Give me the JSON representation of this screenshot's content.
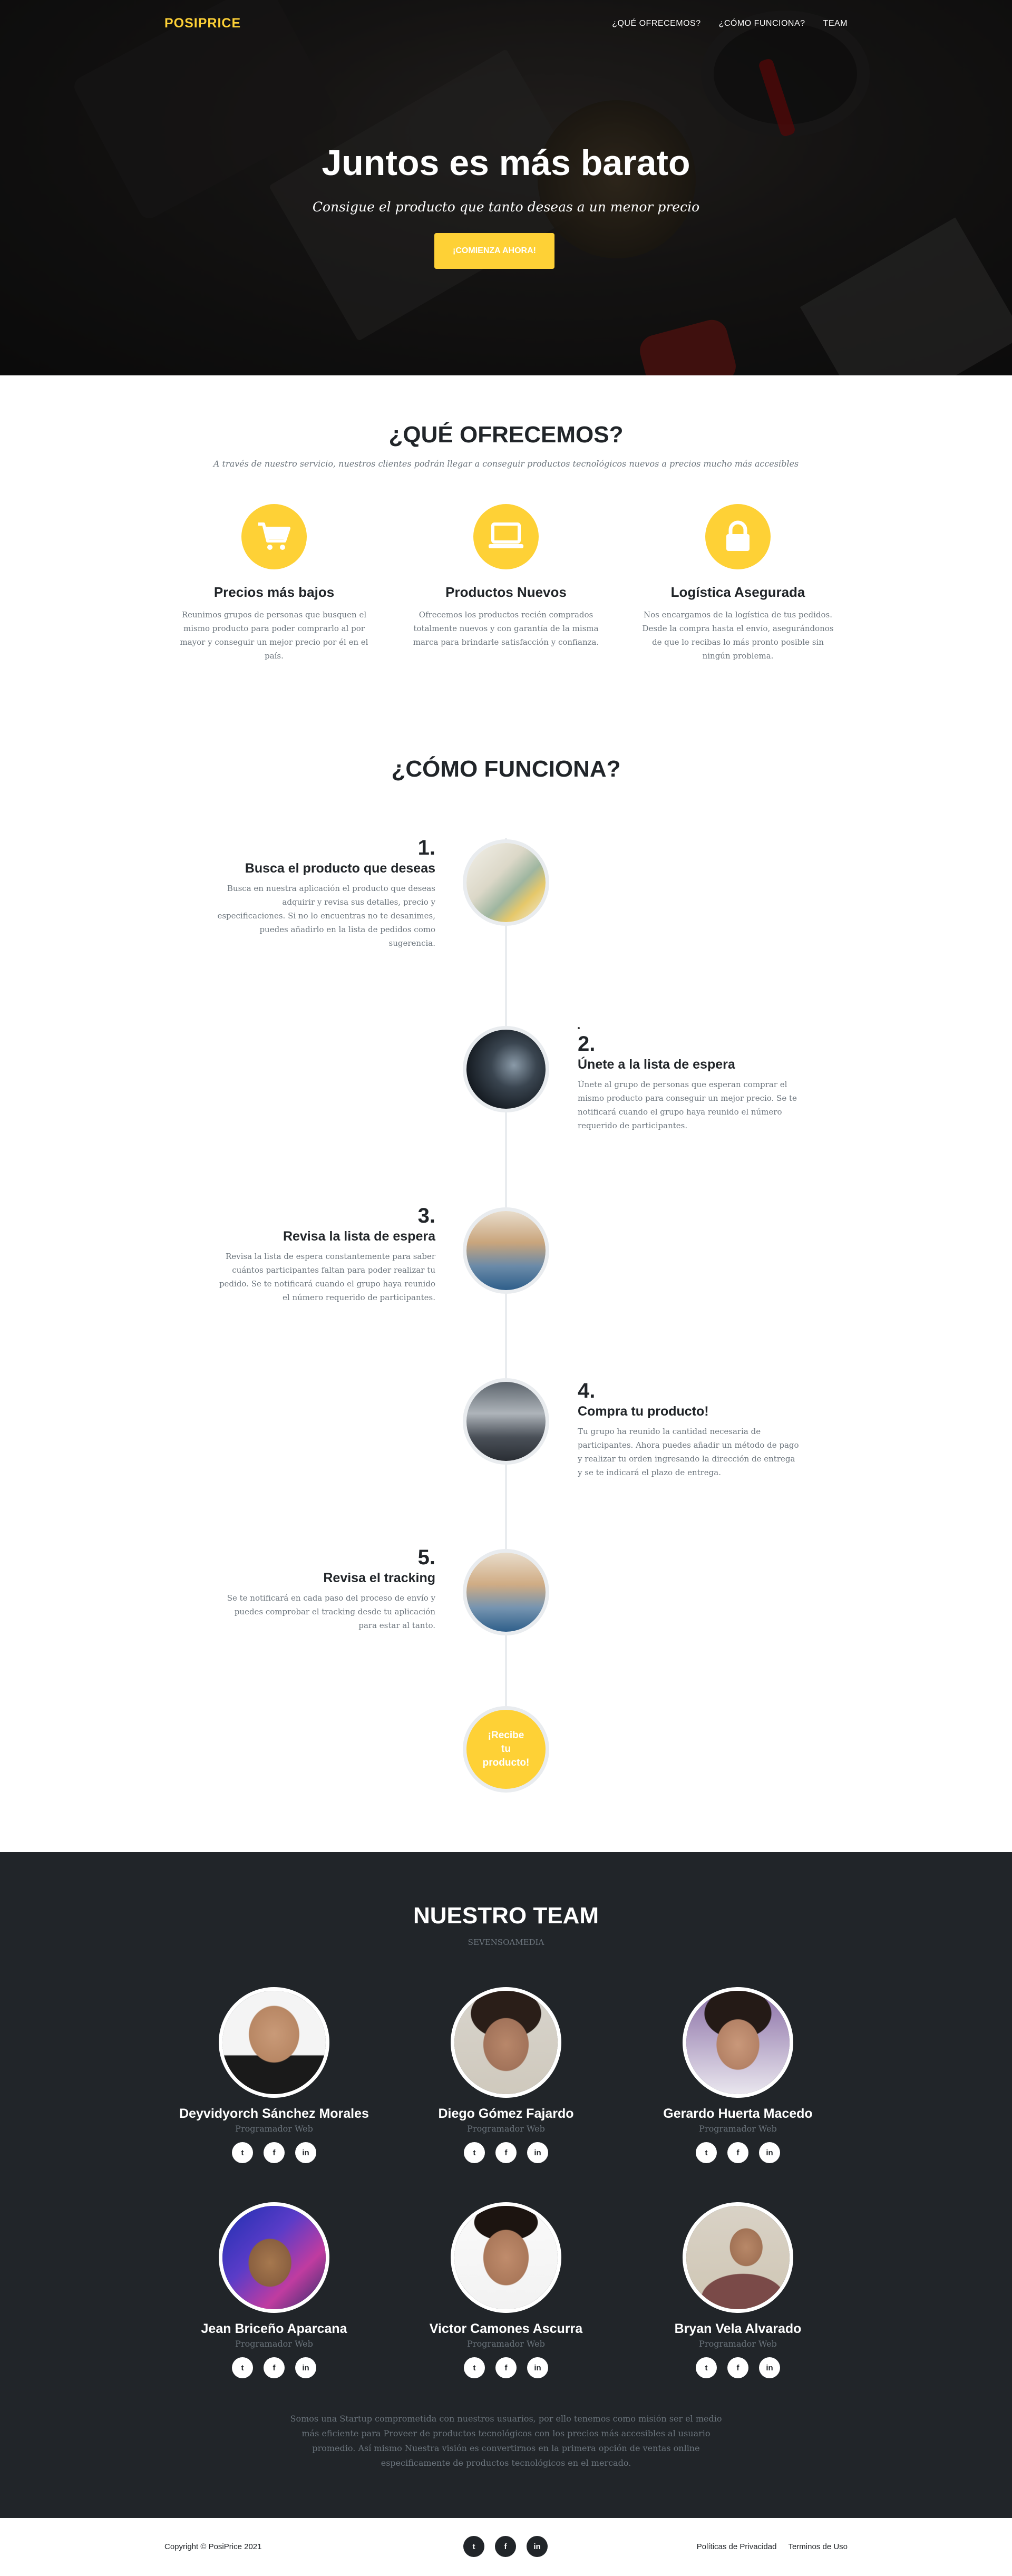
{
  "nav": {
    "brand": "POSIPRICE",
    "items": [
      "¿QUÉ OFRECEMOS?",
      "¿CÓMO FUNCIONA?",
      "TEAM"
    ]
  },
  "hero": {
    "title": "Juntos es más barato",
    "subtitle": "Consigue el producto que tanto deseas a un menor precio",
    "cta": "¡COMIENZA AHORA!"
  },
  "services": {
    "title": "¿QUÉ OFRECEMOS?",
    "subtitle": "A través de nuestro servicio, nuestros clientes podrán llegar a conseguir productos tecnológicos nuevos a precios mucho más accesibles",
    "items": [
      {
        "icon": "shopping-cart-icon",
        "title": "Precios más bajos",
        "text": "Reunimos grupos de personas que busquen el mismo producto para poder comprarlo al por mayor y conseguir un mejor precio por él en el país."
      },
      {
        "icon": "laptop-icon",
        "title": "Productos Nuevos",
        "text": "Ofrecemos los productos recién comprados totalmente nuevos y con garantía de la misma marca para brindarle satisfacción y confianza."
      },
      {
        "icon": "lock-icon",
        "title": "Logística Asegurada",
        "text": "Nos encargamos de la logística de tus pedidos. Desde la compra hasta el envío, asegurándonos de que lo recibas lo más pronto posible sin ningún problema."
      }
    ]
  },
  "how": {
    "title": "¿CÓMO FUNCIONA?",
    "steps": [
      {
        "num": "1.",
        "title": "Busca el producto que deseas",
        "text": "Busca en nuestra aplicación el producto que deseas adquirir y revisa sus detalles, precio y especificaciones. Si no lo encuentras no te desanimes, puedes añadirlo en la lista de pedidos como sugerencia."
      },
      {
        "num": "2.",
        "title": "Únete a la lista de espera",
        "text": "Únete al grupo de personas que esperan comprar el mismo producto para conseguir un mejor precio. Se te notificará cuando el grupo haya reunido el número requerido de participantes."
      },
      {
        "num": "3.",
        "title": "Revisa la lista de espera",
        "text": "Revisa la lista de espera constantemente para saber cuántos participantes faltan para poder realizar tu pedido. Se te notificará cuando el grupo haya reunido el número requerido de participantes."
      },
      {
        "num": "4.",
        "title": "Compra tu producto!",
        "text": "Tu grupo ha reunido la cantidad necesaria de participantes. Ahora puedes añadir un método de pago y realizar tu orden ingresando la dirección de entrega y se te indicará el plazo de entrega."
      },
      {
        "num": "5.",
        "title": "Revisa el tracking",
        "text": "Se te notificará en cada paso del proceso de envío y puedes comprobar el tracking desde tu aplicación para estar al tanto."
      }
    ],
    "final": [
      "¡Recibe",
      "tu",
      "producto!"
    ]
  },
  "team": {
    "title": "NUESTRO TEAM",
    "subtitle": "SEVENSOAMEDIA",
    "members": [
      {
        "name": "Deyvidyorch Sánchez Morales",
        "role": "Programador Web"
      },
      {
        "name": "Diego Gómez Fajardo",
        "role": "Programador Web"
      },
      {
        "name": "Gerardo Huerta Macedo",
        "role": "Programador Web"
      },
      {
        "name": "Jean Briceño Aparcana",
        "role": "Programador Web"
      },
      {
        "name": "Victor Camones Ascurra",
        "role": "Programador Web"
      },
      {
        "name": "Bryan Vela Alvarado",
        "role": "Programador Web"
      }
    ],
    "social": [
      "t",
      "f",
      "in"
    ],
    "about": "Somos una Startup comprometida con nuestros usuarios, por ello tenemos como misión ser el medio más eficiente para Proveer de productos tecnológicos con los precios más accesibles al usuario promedio. Así mismo Nuestra visión es convertirnos en la primera opción de ventas online especificamente de productos tecnológicos en el mercado."
  },
  "footer": {
    "copyright": "Copyright © PosiPrice 2021",
    "links": [
      "Políticas de Privacidad",
      "Terminos de Uso"
    ]
  },
  "colors": {
    "accent": "#fed136",
    "dark": "#212529",
    "muted": "#6c757d"
  }
}
